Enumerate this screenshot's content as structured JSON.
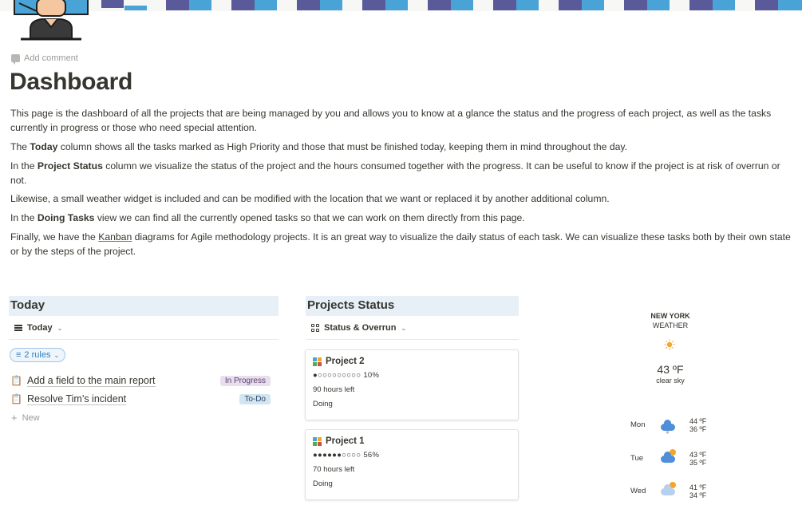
{
  "page": {
    "add_comment": "Add comment",
    "title": "Dashboard",
    "intro": "This page is the dashboard of all the projects that are being managed by you and allows you to know at a glance the status and the progress of each project, as well as the tasks currently in progress or those who need special attention.",
    "p2_before": "The ",
    "p2_bold": "Today",
    "p2_after": " column shows all the tasks marked as High Priority and those that must be finished today, keeping them in mind throughout the day.",
    "p3_before": "In the ",
    "p3_bold": "Project Status",
    "p3_after": " column we visualize the status of the project and the hours consumed together with the progress. It can be useful to know if the project is at risk of overrun or not.",
    "p4": "Likewise, a small weather widget is included and can be modified with the location that we want or replaced it by another additional column.",
    "p5_before": "In the ",
    "p5_bold": "Doing Tasks",
    "p5_after": " view we can find all the currently opened tasks so that we can work on them directly from this page.",
    "p6_before": "Finally, we have the ",
    "p6_link": "Kanban",
    "p6_after": " diagrams for Agile methodology projects. It is an great way to visualize the daily status of each task. We can visualize these tasks both by their own state or by the steps of the project."
  },
  "today": {
    "header": "Today",
    "view_label": "Today",
    "rules": "2 rules",
    "tasks": [
      {
        "name": "Add a field to the main report",
        "status": "In Progress"
      },
      {
        "name": "Resolve Tim’s incident",
        "status": "To-Do"
      }
    ],
    "new_label": "New"
  },
  "projects": {
    "header": "Projects Status",
    "view_label": "Status & Overrun",
    "cards": [
      {
        "name": "Project 2",
        "progress_bar": "●○○○○○○○○○",
        "progress_pct": "10%",
        "hours": "90 hours left",
        "status": "Doing"
      },
      {
        "name": "Project 1",
        "progress_bar": "●●●●●●○○○○",
        "progress_pct": "56%",
        "hours": "70 hours left",
        "status": "Doing"
      }
    ]
  },
  "weather": {
    "city": "NEW YORK",
    "sub": "WEATHER",
    "temp": "43 ºF",
    "condition": "clear sky",
    "forecast": [
      {
        "day": "Mon",
        "high": "44 ºF",
        "low": "36 ºF",
        "icon": "snow-cloud-icon"
      },
      {
        "day": "Tue",
        "high": "43 ºF",
        "low": "35 ºF",
        "icon": "sun-cloud-icon"
      },
      {
        "day": "Wed",
        "high": "41 ºF",
        "low": "34 ºF",
        "icon": "sun-cloud-icon"
      }
    ]
  },
  "colors": {
    "banner_purple": "#5a5a9a",
    "banner_blue": "#4aa3d6",
    "section_header_bg": "#e7f0f7",
    "tag_in_progress": "#e8deee",
    "tag_todo": "#d3e5ef"
  }
}
